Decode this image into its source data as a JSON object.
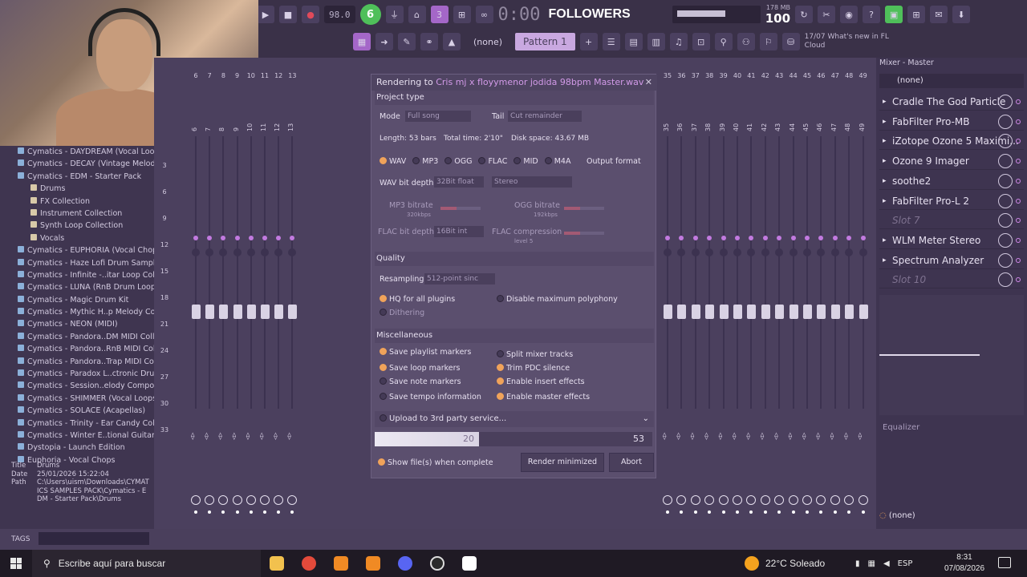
{
  "toolbar": {
    "tempo": "98.0",
    "badge": "6",
    "time": "0:00",
    "overlay_title": "FOLLOWERS",
    "counter": "100",
    "memory": "178 MB",
    "pattern_selector": "(none)",
    "pattern": "Pattern 1",
    "news_date": "17/07",
    "news_text": "What's new in FL",
    "news_sub": "Cloud"
  },
  "browser": {
    "items": [
      {
        "label": "Cymatics - DAYDREAM (Vocal Loops)",
        "sub": false
      },
      {
        "label": "Cymatics - DECAY (Vintage Melodies)",
        "sub": false
      },
      {
        "label": "Cymatics - EDM - Starter Pack",
        "sub": false
      },
      {
        "label": "Drums",
        "sub": true
      },
      {
        "label": "FX Collection",
        "sub": true
      },
      {
        "label": "Instrument Collection",
        "sub": true
      },
      {
        "label": "Synth Loop Collection",
        "sub": true
      },
      {
        "label": "Vocals",
        "sub": true
      },
      {
        "label": "Cymatics - EUPHORIA (Vocal Chops)",
        "sub": false
      },
      {
        "label": "Cymatics - Haze Lofi Drum Samples",
        "sub": false
      },
      {
        "label": "Cymatics - Infinite -..itar Loop Collection",
        "sub": false
      },
      {
        "label": "Cymatics - LUNA (RnB Drum Loops)",
        "sub": false
      },
      {
        "label": "Cymatics - Magic Drum Kit",
        "sub": false
      },
      {
        "label": "Cymatics - Mythic H..p Melody Collection",
        "sub": false
      },
      {
        "label": "Cymatics - NEON (MIDI)",
        "sub": false
      },
      {
        "label": "Cymatics - Pandora..DM MIDI Collection",
        "sub": false
      },
      {
        "label": "Cymatics - Pandora..RnB MIDI Collection",
        "sub": false
      },
      {
        "label": "Cymatics - Pandora..Trap MIDI Collection",
        "sub": false
      },
      {
        "label": "Cymatics - Paradox L..ctronic Drum Loops",
        "sub": false
      },
      {
        "label": "Cymatics - Session..elody Compositions",
        "sub": false
      },
      {
        "label": "Cymatics - SHIMMER (Vocal Loops)",
        "sub": false
      },
      {
        "label": "Cymatics - SOLACE (Acapellas)",
        "sub": false
      },
      {
        "label": "Cymatics - Trinity - Ear Candy Collection",
        "sub": false
      },
      {
        "label": "Cymatics - Winter E..tional Guitar Loops",
        "sub": false
      },
      {
        "label": "Dystopia - Launch Edition",
        "sub": false
      },
      {
        "label": "Euphoria - Vocal Chops",
        "sub": false
      }
    ],
    "meta": {
      "title_key": "Title",
      "title_val": "Drums",
      "date_key": "Date",
      "date_val": "25/01/2026 15:22:04",
      "path_key": "Path",
      "path_val": "C:\\Users\\uism\\Downloads\\CYMATICS SAMPLES PACK\\Cymatics - EDM - Starter Pack\\Drums"
    },
    "tags": "TAGS"
  },
  "mixer": {
    "row_numbers": [
      "3",
      "6",
      "9",
      "12",
      "15",
      "18",
      "21",
      "24",
      "27",
      "30",
      "33"
    ],
    "left_strips": [
      "6",
      "7",
      "8",
      "9",
      "10",
      "11",
      "12",
      "13"
    ],
    "right_strips": [
      "35",
      "36",
      "37",
      "38",
      "39",
      "40",
      "41",
      "42",
      "43",
      "44",
      "45",
      "46",
      "47",
      "48",
      "49"
    ]
  },
  "render": {
    "title_prefix": "Rendering to ",
    "filename": "Cris mj x floyymenor jodida 98bpm Master.wav",
    "project_type": "Project type",
    "mode_label": "Mode",
    "mode_value": "Full song",
    "tail_label": "Tail",
    "tail_value": "Cut remainder",
    "length": "Length: 53 bars",
    "total_time": "Total time: 2'10\"",
    "disk_space": "Disk space: 43.67 MB",
    "formats": [
      "WAV",
      "MP3",
      "OGG",
      "FLAC",
      "MID",
      "M4A"
    ],
    "output_format": "Output format",
    "wav_bit_depth_label": "WAV bit depth",
    "wav_bit_depth_value": "32Bit float",
    "stereo": "Stereo",
    "mp3_bitrate": "MP3 bitrate",
    "mp3_bitrate_value": "320kbps",
    "ogg_bitrate": "OGG bitrate",
    "ogg_bitrate_value": "192kbps",
    "flac_bit_depth": "FLAC bit depth",
    "flac_bit_depth_value": "16Bit int",
    "flac_compression": "FLAC compression",
    "flac_compression_value": "level 5",
    "quality": "Quality",
    "resampling_label": "Resampling",
    "resampling_value": "512-point sinc",
    "hq_plugins": "HQ for all plugins",
    "disable_polyphony": "Disable maximum polyphony",
    "dithering": "Dithering",
    "misc": "Miscellaneous",
    "save_playlist": "Save playlist markers",
    "save_loop": "Save loop markers",
    "save_note": "Save note markers",
    "save_tempo": "Save tempo information",
    "split_mixer": "Split mixer tracks",
    "trim_pdc": "Trim PDC silence",
    "enable_insert": "Enable insert effects",
    "enable_master": "Enable master effects",
    "upload": "Upload to 3rd party service...",
    "progress_current": "20",
    "progress_total": "53",
    "progress_fraction": 0.377,
    "show_files": "Show file(s) when complete",
    "render_minimized": "Render minimized",
    "abort": "Abort"
  },
  "master": {
    "title": "Mixer - Master",
    "input": "(none)",
    "slots": [
      {
        "label": "Cradle The God Particle",
        "empty": false
      },
      {
        "label": "FabFilter Pro-MB",
        "empty": false
      },
      {
        "label": "iZotope Ozone 5 Maximi...",
        "empty": false
      },
      {
        "label": "Ozone 9 Imager",
        "empty": false
      },
      {
        "label": "soothe2",
        "empty": false
      },
      {
        "label": "FabFilter Pro-L 2",
        "empty": false
      },
      {
        "label": "Slot 7",
        "empty": true
      },
      {
        "label": "WLM Meter Stereo",
        "empty": false
      },
      {
        "label": "Spectrum Analyzer",
        "empty": false
      },
      {
        "label": "Slot 10",
        "empty": true
      }
    ],
    "equalizer": "Equalizer",
    "output": "(none)"
  },
  "taskbar": {
    "search_placeholder": "Escribe aquí para buscar",
    "weather": "22°C Soleado",
    "lang": "ESP",
    "time": "8:31",
    "date": "07/08/2026"
  },
  "colors": {
    "accent": "#a467c8",
    "orange": "#f0a35a",
    "background": "#4a3f5c"
  }
}
